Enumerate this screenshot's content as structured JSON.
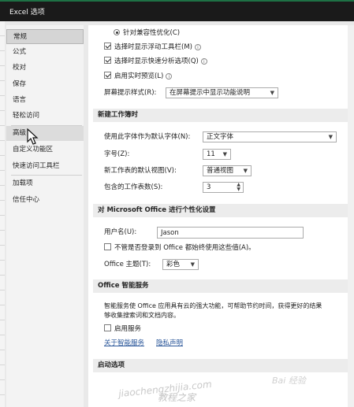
{
  "window": {
    "title": "Excel 选项"
  },
  "sidebar": {
    "items": [
      {
        "label": "常规",
        "selected": true
      },
      {
        "label": "公式"
      },
      {
        "label": "校对"
      },
      {
        "label": "保存"
      },
      {
        "label": "语言"
      },
      {
        "label": "轻松访问"
      },
      {
        "label": "高级",
        "hover": true
      },
      {
        "label": "自定义功能区"
      },
      {
        "label": "快速访问工具栏"
      },
      {
        "label": "加载项"
      },
      {
        "label": "信任中心"
      }
    ]
  },
  "ui_options": {
    "compat_radio": "针对兼容性优化(C)",
    "mini_toolbar": "选择时显示浮动工具栏(M)",
    "quick_analysis": "选择时显示快速分析选项(Q)",
    "live_preview": "启用实时预览(L)",
    "screentip_label": "屏幕提示样式(R):",
    "screentip_value": "在屏幕提示中显示功能说明"
  },
  "new_workbook": {
    "header": "新建工作簿时",
    "font_label": "使用此字体作为默认字体(N):",
    "font_value": "正文字体",
    "size_label": "字号(Z):",
    "size_value": "11",
    "view_label": "新工作表的默认视图(V):",
    "view_value": "普通视图",
    "sheets_label": "包含的工作表数(S):",
    "sheets_value": "3"
  },
  "personalize": {
    "header": "对 Microsoft Office 进行个性化设置",
    "username_label": "用户名(U):",
    "username_value": "Jason",
    "always_use": "不管是否登录到 Office 都始终使用这些值(A)。",
    "theme_label": "Office 主题(T):",
    "theme_value": "彩色"
  },
  "intelligent": {
    "header": "Office 智能服务",
    "description": "智能服务使 Office 应用具有云的强大功能，可帮助节约时间，获得更好的结果",
    "description2": "够收集搜索词和文档内容。",
    "enable": "启用服务",
    "link_about": "关于智能服务",
    "link_privacy": "隐私声明"
  },
  "startup": {
    "header": "启动选项"
  },
  "watermarks": {
    "site": "jiaochengzhijia.com",
    "cn": "教程之家",
    "baidu": "Bai 经验"
  }
}
